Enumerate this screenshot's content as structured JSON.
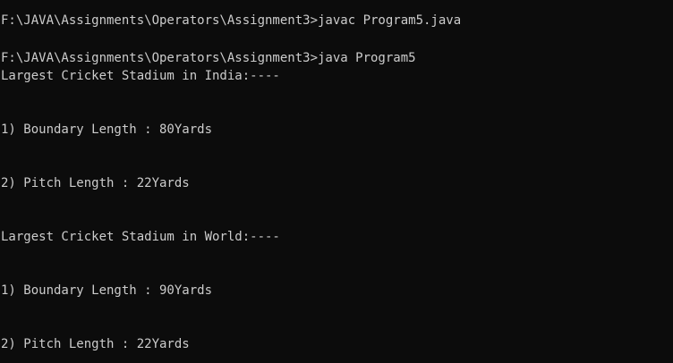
{
  "terminal": {
    "lines": [
      "F:\\JAVA\\Assignments\\Operators\\Assignment3>javac Program5.java",
      "F:\\JAVA\\Assignments\\Operators\\Assignment3>java Program5",
      "Largest Cricket Stadium in India:----",
      "1) Boundary Length : 80Yards",
      "2) Pitch Length : 22Yards",
      "Largest Cricket Stadium in World:----",
      "1) Boundary Length : 90Yards",
      "2) Pitch Length : 22Yards"
    ]
  }
}
